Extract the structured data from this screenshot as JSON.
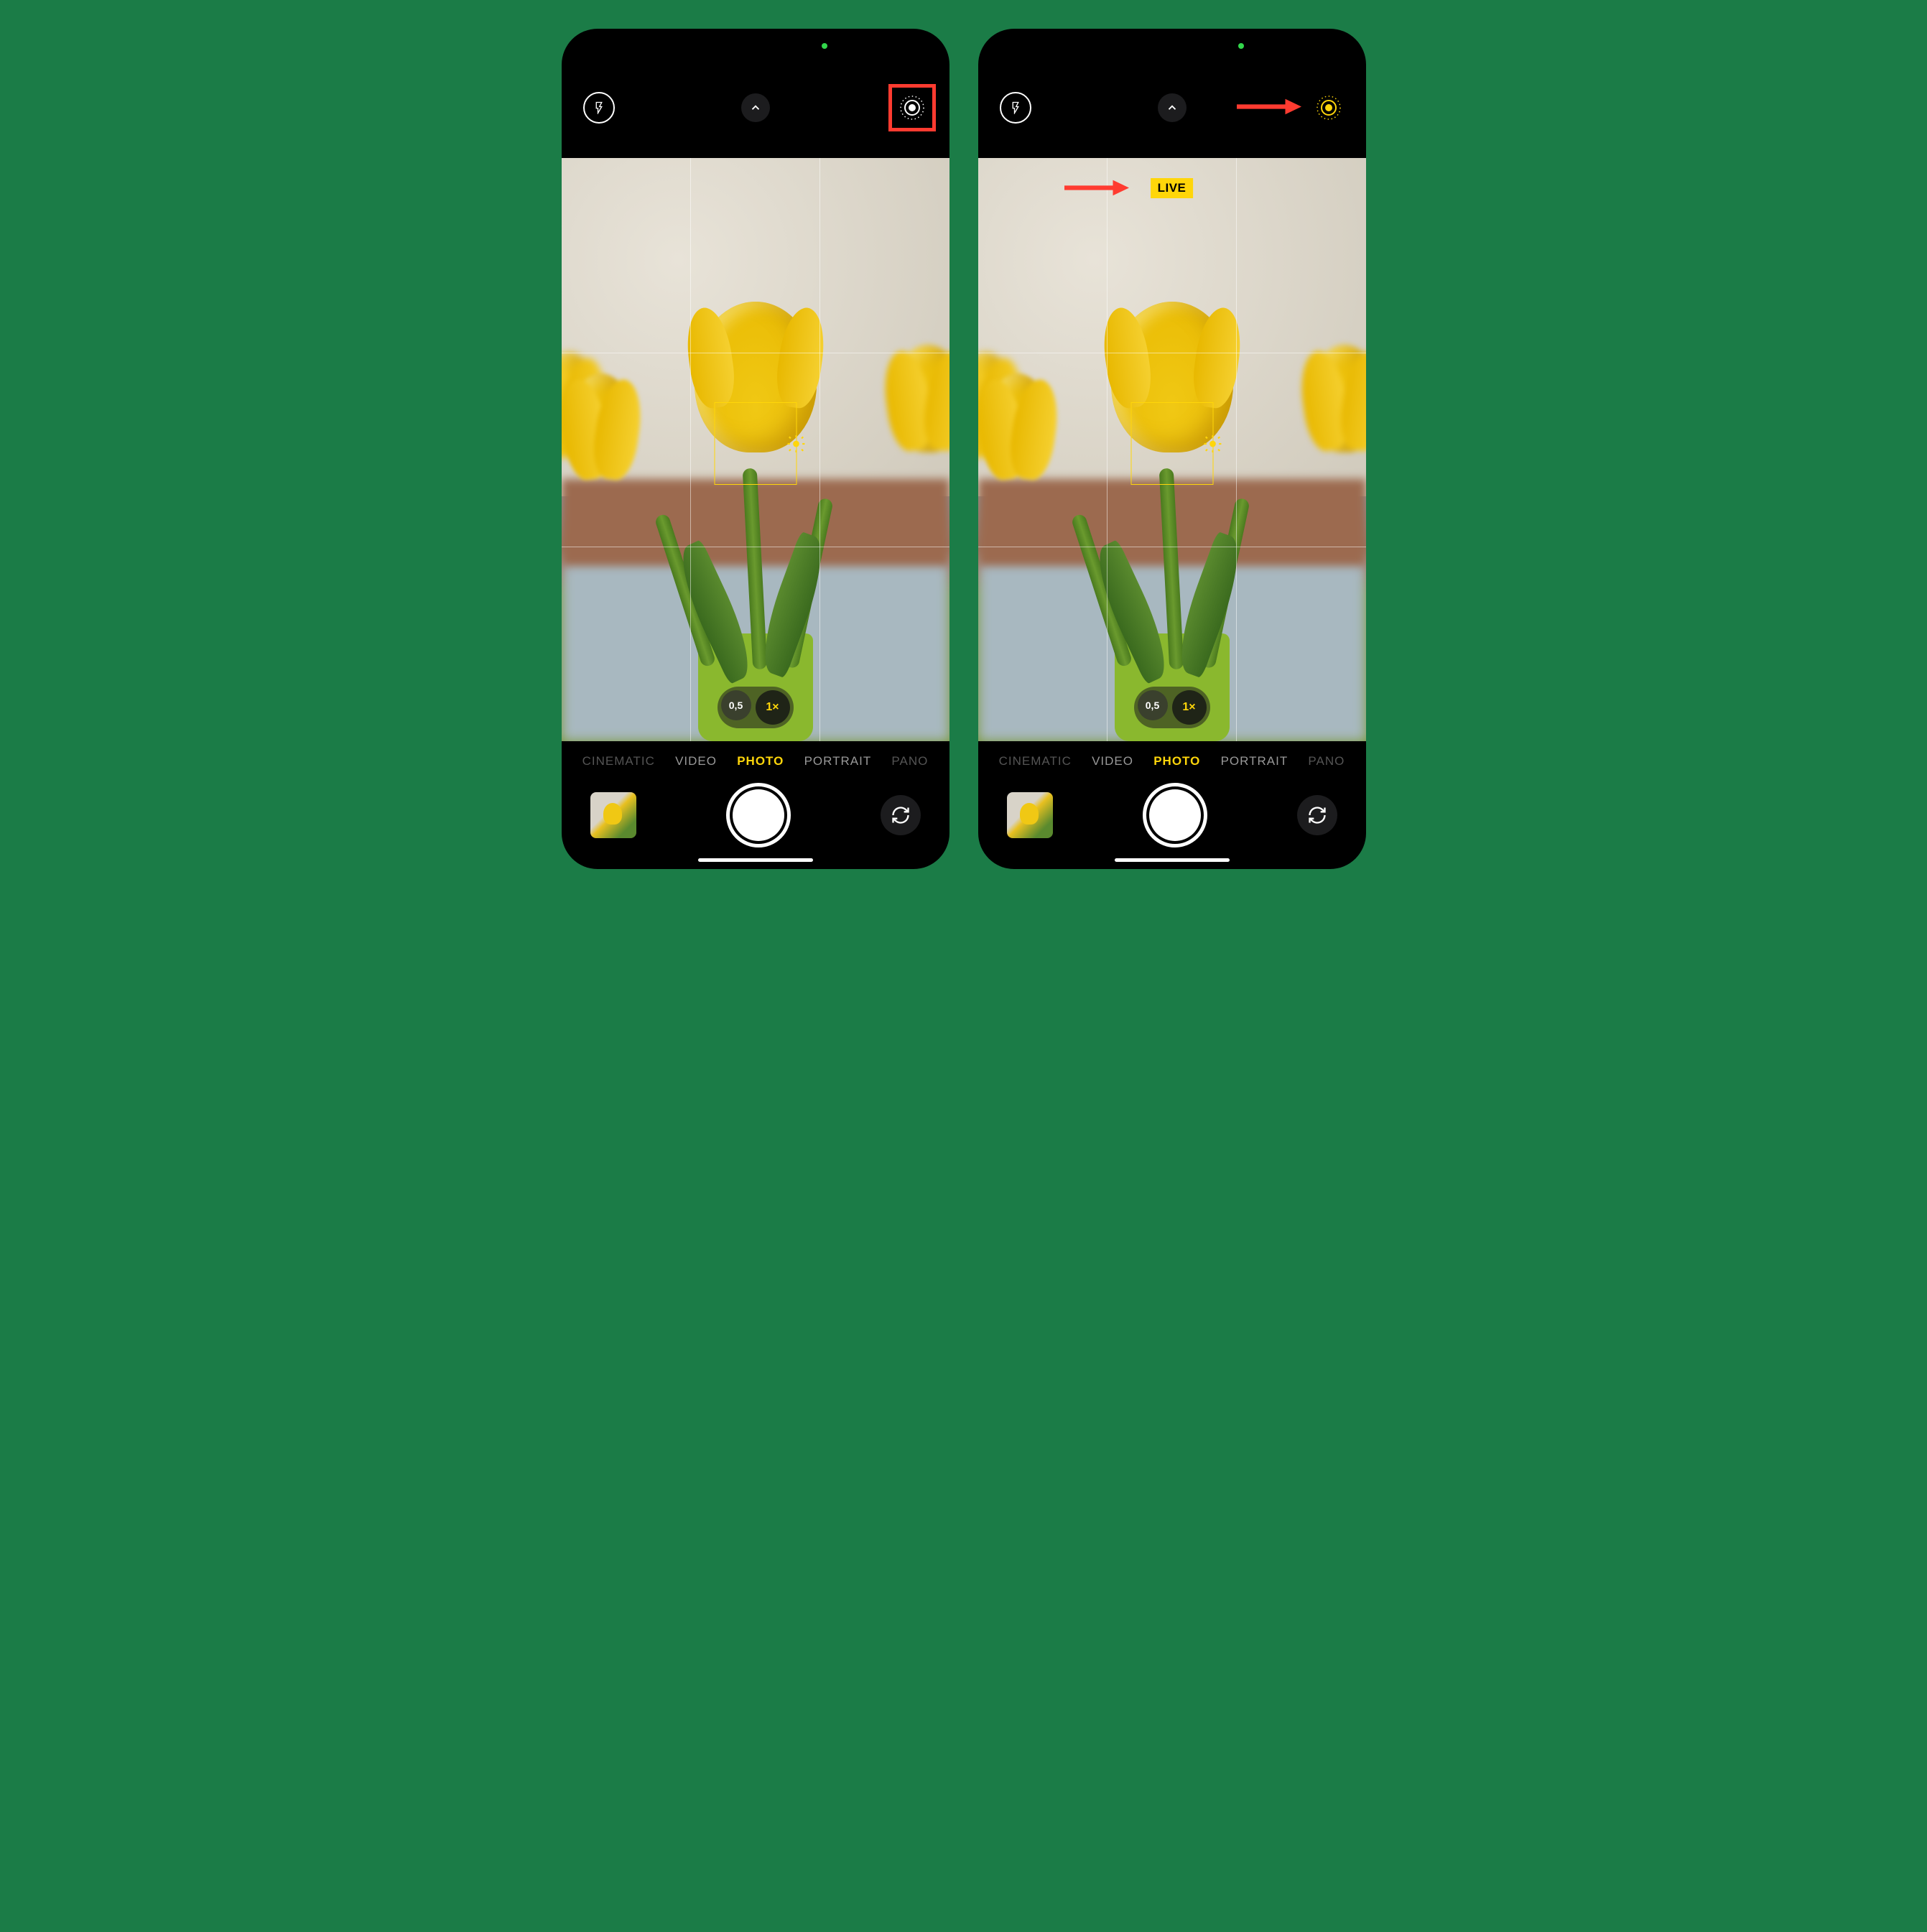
{
  "left_panel": {
    "live_photo_state": "off",
    "live_photo_color": "#ffffff",
    "live_photo_highlight": true,
    "show_live_badge": false,
    "show_arrow_top": false,
    "show_arrow_live": false
  },
  "right_panel": {
    "live_photo_state": "on",
    "live_photo_color": "#ffd60a",
    "live_photo_highlight": false,
    "show_live_badge": true,
    "show_arrow_top": true,
    "show_arrow_live": true
  },
  "live_badge_text": "LIVE",
  "zoom": {
    "options": [
      "0,5",
      "1×"
    ],
    "active_index": 1
  },
  "modes": [
    {
      "label": "CINEMATIC",
      "state": "faded"
    },
    {
      "label": "VIDEO",
      "state": "normal"
    },
    {
      "label": "PHOTO",
      "state": "active"
    },
    {
      "label": "PORTRAIT",
      "state": "normal"
    },
    {
      "label": "PANO",
      "state": "faded"
    }
  ],
  "colors": {
    "accent_yellow": "#ffd60a",
    "annotation_red": "#ff3b30",
    "status_green": "#32d74b"
  },
  "icons": {
    "flash": "flash-icon",
    "chevron_up": "chevron-up-icon",
    "live_photo": "live-photo-icon",
    "camera_flip": "camera-flip-icon",
    "sun": "exposure-sun-icon"
  }
}
